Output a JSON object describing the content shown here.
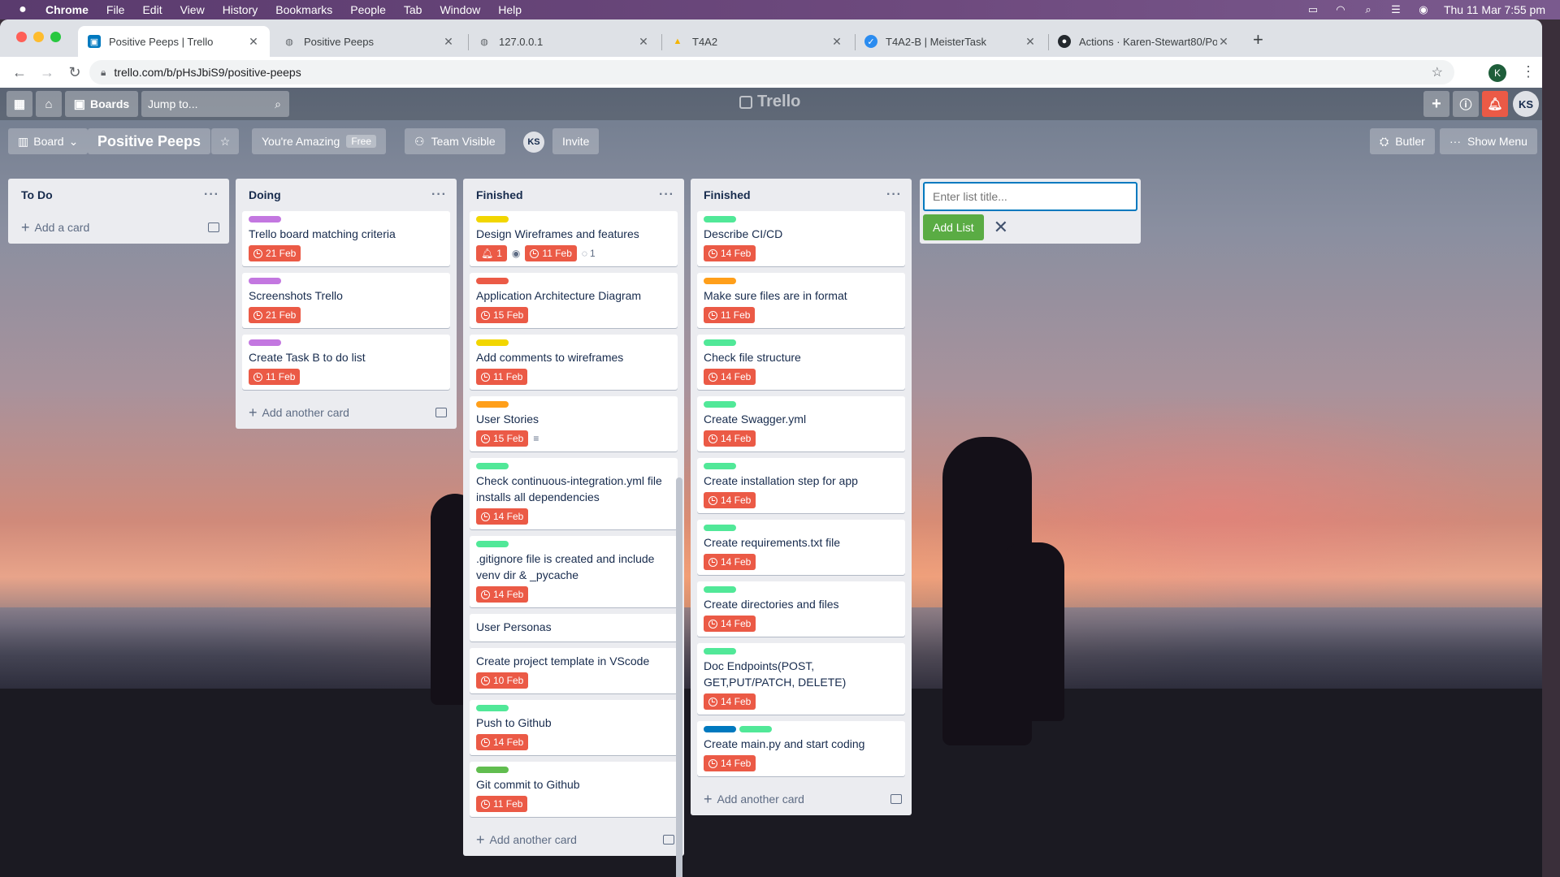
{
  "mac": {
    "apple": "",
    "menus": [
      "Chrome",
      "File",
      "Edit",
      "View",
      "History",
      "Bookmarks",
      "People",
      "Tab",
      "Window",
      "Help"
    ],
    "clock": "Thu 11 Mar  7:55 pm"
  },
  "browser": {
    "tabs": [
      {
        "label": "Positive Peeps | Trello",
        "icon": "trello-favicon",
        "active": true
      },
      {
        "label": "Positive Peeps",
        "icon": "globe-icon"
      },
      {
        "label": "127.0.0.1",
        "icon": "globe-icon"
      },
      {
        "label": "T4A2",
        "icon": "drive-icon"
      },
      {
        "label": "T4A2-B | MeisterTask",
        "icon": "check-circle-icon"
      },
      {
        "label": "Actions · Karen-Stewart80/Pos",
        "icon": "github-icon"
      }
    ],
    "url": "trello.com/b/pHsJbiS9/positive-peeps",
    "profile_initial": "K"
  },
  "trello": {
    "header": {
      "boards_label": "Boards",
      "search_placeholder": "Jump to...",
      "logo": "Trello",
      "user_initials": "KS"
    },
    "board": {
      "view_label": "Board",
      "title": "Positive Peeps",
      "team_label": "You're Amazing",
      "team_badge": "Free",
      "visibility_label": "Team Visible",
      "member_initials": "KS",
      "invite_label": "Invite",
      "butler_label": "Butler",
      "show_menu_label": "Show Menu"
    },
    "lists": [
      {
        "title": "To Do",
        "footer": "Add a card",
        "cards": []
      },
      {
        "title": "Doing",
        "footer": "Add another card",
        "cards": [
          {
            "labels": [
              "#c377e0"
            ],
            "title": "Trello board matching criteria",
            "due": "21 Feb"
          },
          {
            "labels": [
              "#c377e0"
            ],
            "title": "Screenshots Trello",
            "due": "21 Feb"
          },
          {
            "labels": [
              "#c377e0"
            ],
            "title": "Create Task B to do list",
            "due": "11 Feb"
          }
        ]
      },
      {
        "title": "Finished",
        "footer": "Add another card",
        "cards": [
          {
            "labels": [
              "#f2d600"
            ],
            "title": "Design Wireframes and features",
            "due": "11 Feb",
            "alert": "1",
            "watch": true,
            "comments": "1"
          },
          {
            "labels": [
              "#eb5a46"
            ],
            "title": "Application Architecture Diagram",
            "due": "15 Feb"
          },
          {
            "labels": [
              "#f2d600"
            ],
            "title": "Add comments to wireframes",
            "due": "11 Feb"
          },
          {
            "labels": [
              "#ff9f1a"
            ],
            "title": "User Stories",
            "due": "15 Feb",
            "description": true
          },
          {
            "labels": [
              "#51e898"
            ],
            "title": "Check continuous-integration.yml file installs all dependencies",
            "due": "14 Feb"
          },
          {
            "labels": [
              "#51e898"
            ],
            "title": ".gitignore file is created and include venv dir & _pycache",
            "due": "14 Feb"
          },
          {
            "labels": [],
            "title": "User Personas"
          },
          {
            "labels": [],
            "title": "Create project template in VScode",
            "due": "10 Feb"
          },
          {
            "labels": [
              "#51e898"
            ],
            "title": "Push to Github",
            "due": "14 Feb"
          },
          {
            "labels": [
              "#61bd4f"
            ],
            "title": "Git commit to Github",
            "due": "11 Feb"
          }
        ]
      },
      {
        "title": "Finished",
        "footer": "Add another card",
        "cards": [
          {
            "labels": [
              "#51e898"
            ],
            "title": "Describe CI/CD",
            "due": "14 Feb"
          },
          {
            "labels": [
              "#ff9f1a"
            ],
            "title": "Make sure files are in format",
            "due": "11 Feb"
          },
          {
            "labels": [
              "#51e898"
            ],
            "title": "Check file structure",
            "due": "14 Feb"
          },
          {
            "labels": [
              "#51e898"
            ],
            "title": "Create Swagger.yml",
            "due": "14 Feb"
          },
          {
            "labels": [
              "#51e898"
            ],
            "title": "Create installation step for app",
            "due": "14 Feb"
          },
          {
            "labels": [
              "#51e898"
            ],
            "title": "Create requirements.txt file",
            "due": "14 Feb"
          },
          {
            "labels": [
              "#51e898"
            ],
            "title": "Create directories and files",
            "due": "14 Feb"
          },
          {
            "labels": [
              "#51e898"
            ],
            "title": "Doc Endpoints(POST, GET,PUT/PATCH, DELETE)",
            "due": "14 Feb"
          },
          {
            "labels": [
              "#0079bf",
              "#51e898"
            ],
            "title": "Create main.py and start coding",
            "due": "14 Feb"
          }
        ]
      }
    ],
    "add_list": {
      "placeholder": "Enter list title...",
      "button": "Add List"
    }
  }
}
